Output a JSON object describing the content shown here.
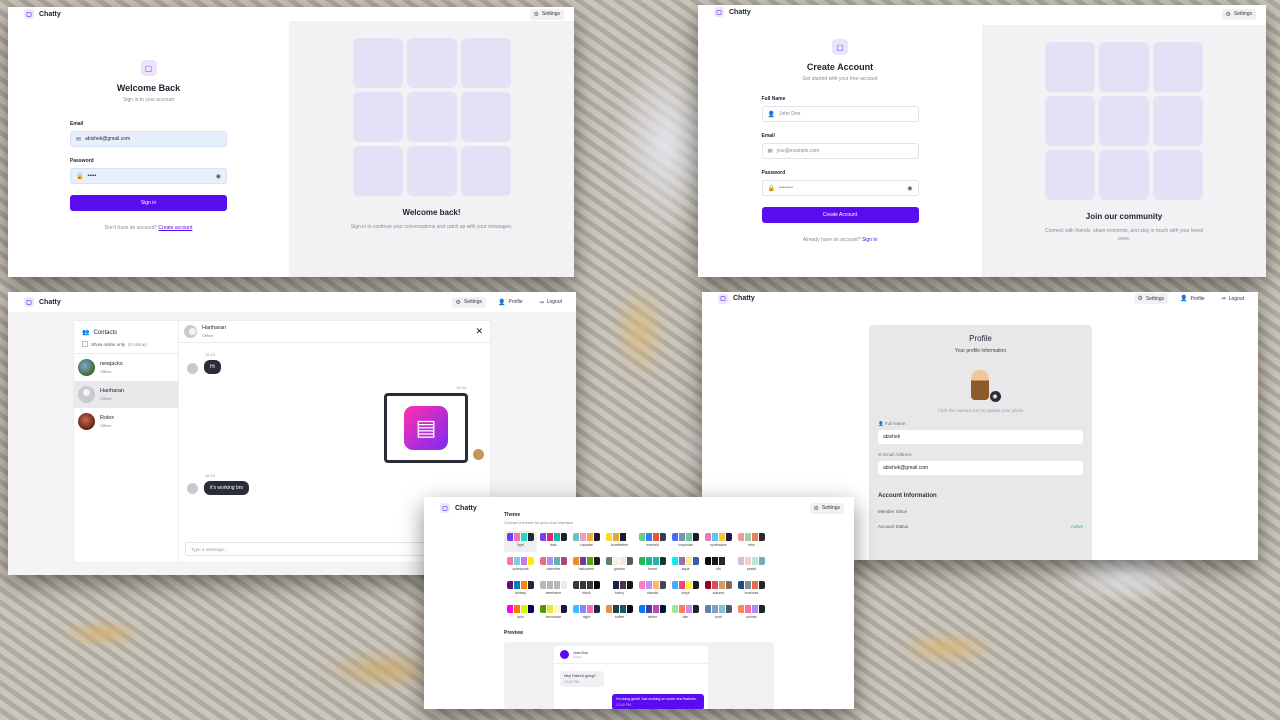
{
  "app": {
    "brand": "Chatty"
  },
  "nav": {
    "settings": "Settings",
    "profile": "Profile",
    "logout": "Logout"
  },
  "login": {
    "title": "Welcome Back",
    "subtitle": "Sign in to your account",
    "email_label": "Email",
    "email_value": "abishek@gmail.com",
    "password_label": "Password",
    "password_value": "•••••",
    "submit": "Sign in",
    "alt_text": "Don't have an account?",
    "alt_link": "Create account",
    "promo_title": "Welcome back!",
    "promo_text": "Sign in to continue your conversations and catch up with your messages."
  },
  "signup": {
    "title": "Create Account",
    "subtitle": "Get started with your free account",
    "name_label": "Full Name",
    "name_placeholder": "John Doe",
    "email_label": "Email",
    "email_placeholder": "you@example.com",
    "password_label": "Password",
    "password_value": "••••••••",
    "submit": "Create Account",
    "alt_text": "Already have an account?",
    "alt_link": "Sign in",
    "promo_title": "Join our community",
    "promo_text": "Connect with friends, share moments, and stay in touch with your loved ones."
  },
  "chat": {
    "contacts_title": "Contacts",
    "online_only": "Show online only",
    "online_count": "(0 online)",
    "contacts": [
      {
        "name": "newjacks",
        "status": "Offline"
      },
      {
        "name": "Hariharan",
        "status": "Offline"
      },
      {
        "name": "Rolex",
        "status": "Offline"
      }
    ],
    "header_name": "Hariharan",
    "header_status": "Offline",
    "messages": [
      {
        "time": "15:23",
        "text": "Hi"
      },
      {
        "time": "15:24",
        "text": ""
      },
      {
        "time": "16:23",
        "text": "it's working bro"
      }
    ],
    "input_placeholder": "Type a message..."
  },
  "profile": {
    "title": "Profile",
    "subtitle": "Your profile information",
    "camera_hint": "Click the camera icon to update your photo",
    "name_label": "Full Name",
    "name_value": "abishek",
    "email_label": "Email Address",
    "email_value": "abishek@gmail.com",
    "account_title": "Account Information",
    "member_since_label": "Member Since",
    "status_label": "Account Status",
    "status_value": "Active"
  },
  "theme": {
    "title": "Theme",
    "subtitle": "Choose a theme for your chat interface",
    "themes": [
      {
        "name": "light",
        "colors": [
          "#6d3cf5",
          "#f472b6",
          "#2dd4bf",
          "#1f2937"
        ]
      },
      {
        "name": "dark",
        "colors": [
          "#7c3aed",
          "#db2777",
          "#14b8a6",
          "#1d232a"
        ]
      },
      {
        "name": "cupcake",
        "colors": [
          "#65c3c8",
          "#ef9fbc",
          "#eeaf3a",
          "#291334"
        ]
      },
      {
        "name": "bumblebee",
        "colors": [
          "#f9d72f",
          "#e0a82e",
          "#181830",
          "#ffffff"
        ]
      },
      {
        "name": "emerald",
        "colors": [
          "#66cc8a",
          "#377cfb",
          "#ea5234",
          "#333c4d"
        ]
      },
      {
        "name": "corporate",
        "colors": [
          "#4b6bfb",
          "#7b92b2",
          "#67cba0",
          "#181a2a"
        ]
      },
      {
        "name": "synthwave",
        "colors": [
          "#e779c1",
          "#58c7f3",
          "#f3cc30",
          "#221551"
        ]
      },
      {
        "name": "retro",
        "colors": [
          "#ef9995",
          "#a4cbb4",
          "#dc8850",
          "#2e282a"
        ]
      },
      {
        "name": "cyberpunk",
        "colors": [
          "#ff7598",
          "#75d1f0",
          "#c07eec",
          "#ffee00"
        ]
      },
      {
        "name": "valentine",
        "colors": [
          "#e96d7b",
          "#a991f7",
          "#66b1b3",
          "#af4670"
        ]
      },
      {
        "name": "halloween",
        "colors": [
          "#f28c18",
          "#6d3a9c",
          "#51a800",
          "#1b1d1d"
        ]
      },
      {
        "name": "garden",
        "colors": [
          "#5c7f67",
          "#ecf4e7",
          "#fae5e5",
          "#5d5656"
        ]
      },
      {
        "name": "forest",
        "colors": [
          "#1eb854",
          "#1db88e",
          "#1db8ab",
          "#19362d"
        ]
      },
      {
        "name": "aqua",
        "colors": [
          "#09ecf3",
          "#966fb3",
          "#ffe999",
          "#345da7"
        ]
      },
      {
        "name": "lofi",
        "colors": [
          "#0d0d0d",
          "#1a1919",
          "#262626",
          "#ffffff"
        ]
      },
      {
        "name": "pastel",
        "colors": [
          "#d1c1d7",
          "#f6cbd1",
          "#b4e9d6",
          "#70acc7"
        ]
      },
      {
        "name": "fantasy",
        "colors": [
          "#6e0b75",
          "#007ebd",
          "#f8860d",
          "#1f2937"
        ]
      },
      {
        "name": "wireframe",
        "colors": [
          "#b8b8b8",
          "#b8b8b8",
          "#b8b8b8",
          "#ebebeb"
        ]
      },
      {
        "name": "black",
        "colors": [
          "#373737",
          "#373737",
          "#373737",
          "#000000"
        ]
      },
      {
        "name": "luxury",
        "colors": [
          "#ffffff",
          "#152747",
          "#513448",
          "#171618"
        ]
      },
      {
        "name": "dracula",
        "colors": [
          "#ff79c6",
          "#bd93f9",
          "#ffb86c",
          "#414558"
        ]
      },
      {
        "name": "cmyk",
        "colors": [
          "#45aeee",
          "#e8488a",
          "#fff232",
          "#1a1a1a"
        ]
      },
      {
        "name": "autumn",
        "colors": [
          "#8c0327",
          "#d85251",
          "#d59b6a",
          "#826a5c"
        ]
      },
      {
        "name": "business",
        "colors": [
          "#1c4e80",
          "#7c909a",
          "#ea6947",
          "#23282e"
        ]
      },
      {
        "name": "acid",
        "colors": [
          "#ff00f4",
          "#ff7400",
          "#cbfd03",
          "#140152"
        ]
      },
      {
        "name": "lemonade",
        "colors": [
          "#519903",
          "#e9e92e",
          "#f7f9ca",
          "#191a3e"
        ]
      },
      {
        "name": "night",
        "colors": [
          "#38bdf8",
          "#818cf8",
          "#f471b5",
          "#1e293b"
        ]
      },
      {
        "name": "coffee",
        "colors": [
          "#db924b",
          "#263e3f",
          "#10576d",
          "#120c12"
        ]
      },
      {
        "name": "winter",
        "colors": [
          "#047aff",
          "#463aa2",
          "#c148ac",
          "#021431"
        ]
      },
      {
        "name": "dim",
        "colors": [
          "#9fe88d",
          "#ff7d5c",
          "#c792e9",
          "#1c212b"
        ]
      },
      {
        "name": "nord",
        "colors": [
          "#5e81ac",
          "#81a1c1",
          "#88c0d0",
          "#4c566a"
        ]
      },
      {
        "name": "sunset",
        "colors": [
          "#ff865b",
          "#fd6f9c",
          "#b387fa",
          "#1b262c"
        ]
      }
    ],
    "preview_label": "Preview",
    "preview_name": "John Doe",
    "preview_status": "Online",
    "preview_msg_in": "Hey! How's it going?",
    "preview_msg_out": "I'm doing great! Just working on some new features.",
    "preview_time": "12:00 PM"
  }
}
